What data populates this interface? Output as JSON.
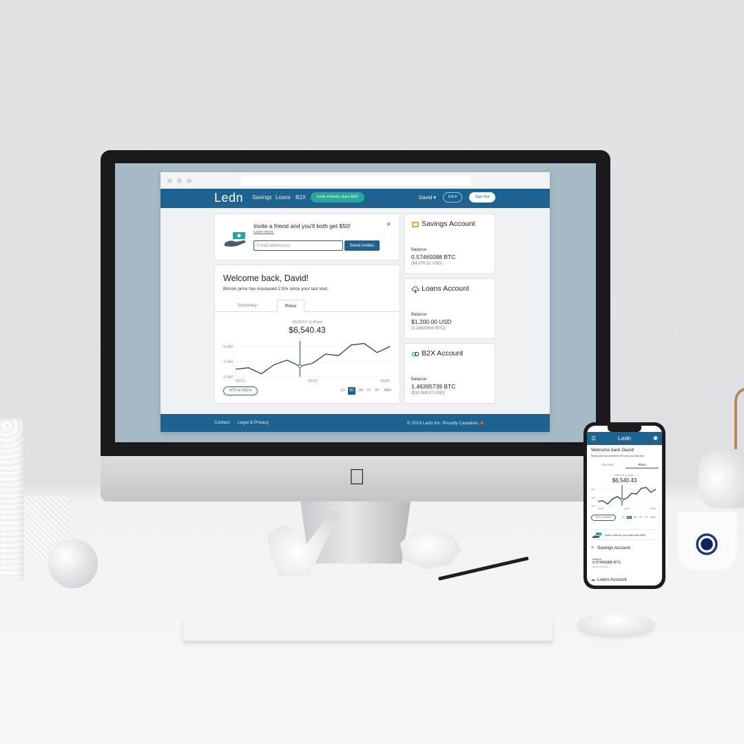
{
  "app": {
    "logo": "Ledn",
    "nav": {
      "links": [
        "Savings",
        "Loans",
        "B2X"
      ],
      "invite_pill": "Invite Friends, Earn $50!",
      "user": "David ▾",
      "lang": "EN ▾",
      "signout": "Sign Out"
    },
    "invite": {
      "title": "Invite a friend and you'll both get $50!",
      "learn_more": "Learn more.",
      "email_placeholder": "Email addresses",
      "send_button": "Send invites",
      "close": "×"
    },
    "welcome": {
      "title": "Welcome back, David!",
      "subtitle": "Bitcoin price has increased 2.5% since your last visit.",
      "tabs": [
        "Summary",
        "Price"
      ],
      "active_tab": "Price",
      "date": "06/02/19 11:41am",
      "price": "$6,540.43",
      "pair_select": "BTC to USD ▾",
      "ranges": [
        "1D",
        "5D",
        "1M",
        "1Y",
        "5Y",
        "MAX"
      ],
      "active_range": "5D"
    },
    "accounts": [
      {
        "icon": "piggy-bank-icon",
        "title": "Savings Account",
        "balance_label": "Balance:",
        "balance": "0.57465088 BTC",
        "sub": "($4,070.32 USD)"
      },
      {
        "icon": "cloud-icon",
        "title": "Loans Account",
        "balance_label": "Balance:",
        "balance": "$1,200.00 USD",
        "sub": "(0.16920000 BTC)"
      },
      {
        "icon": "link-icon",
        "title": "B2X Account",
        "balance_label": "Balance:",
        "balance": "1.46395739 BTC",
        "sub": "($10,369.37 USD)"
      }
    ],
    "footer": {
      "links": [
        "Contact",
        "Legal & Privacy"
      ],
      "copyright": "© 2019 Ledn Inc. Proudly Canadian 🍁"
    },
    "colors": {
      "brand": "#1e6390",
      "accent": "#28a79b"
    }
  },
  "phone": {
    "logo": "Ledn",
    "welcome": "Welcome back David!",
    "subtitle": "Bitcoin price has increased 2.5% since your last visit.",
    "tabs": [
      "Summary",
      "Price"
    ],
    "date": "06/02/19 11:41am",
    "price": "$6,540.43",
    "pair": "BTC to USD ▾",
    "ranges": [
      "1D",
      "5D",
      "1M",
      "1Y",
      "5Y",
      "MAX"
    ],
    "invite": "Invite a friend, you both earn $50!",
    "savings_title": "Savings Account",
    "loans_title": "Loans Account",
    "balance_label": "Balance:",
    "balance": "0.57465088 BTC",
    "balance_sub": "($4,070.32 USD)"
  },
  "chart_data": {
    "type": "line",
    "x_ticks": [
      "06/01",
      "06/03",
      "06/05"
    ],
    "y_ticks": [
      "8,000",
      "7,000",
      "6,000"
    ],
    "ylim": [
      6000,
      8000
    ],
    "series": [
      {
        "values": [
          6500,
          6600,
          6200,
          6800,
          7100,
          6700,
          6900,
          7500,
          7400,
          8100,
          8200,
          7600,
          8000
        ]
      }
    ],
    "highlight_index": 5
  }
}
